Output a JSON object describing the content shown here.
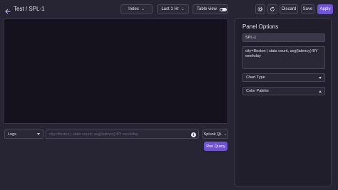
{
  "header": {
    "back_icon": "arrow-left-icon",
    "title": "Test / SPL-1",
    "index_label": "Index",
    "time_label": "Last 1 Hr",
    "table_view_label": "Table view",
    "table_view_on": false,
    "discard_label": "Discard",
    "save_label": "Save",
    "apply_label": "Apply"
  },
  "query": {
    "datasource": "Logs",
    "text": "city=Boston | stats count, avg(latency) BY weekday",
    "language": "Splunk QL",
    "run_label": "Run Query"
  },
  "panel_options": {
    "heading": "Panel Options",
    "name_value": "SPL-1",
    "description": "city=Boston | stats count, avg(latency) BY weekday",
    "chart_type_label": "Chart Type",
    "color_palette_label": "Color Palette"
  },
  "colors": {
    "accent": "#6f52d9",
    "background": "#272433",
    "chart_area": "#15121e"
  }
}
